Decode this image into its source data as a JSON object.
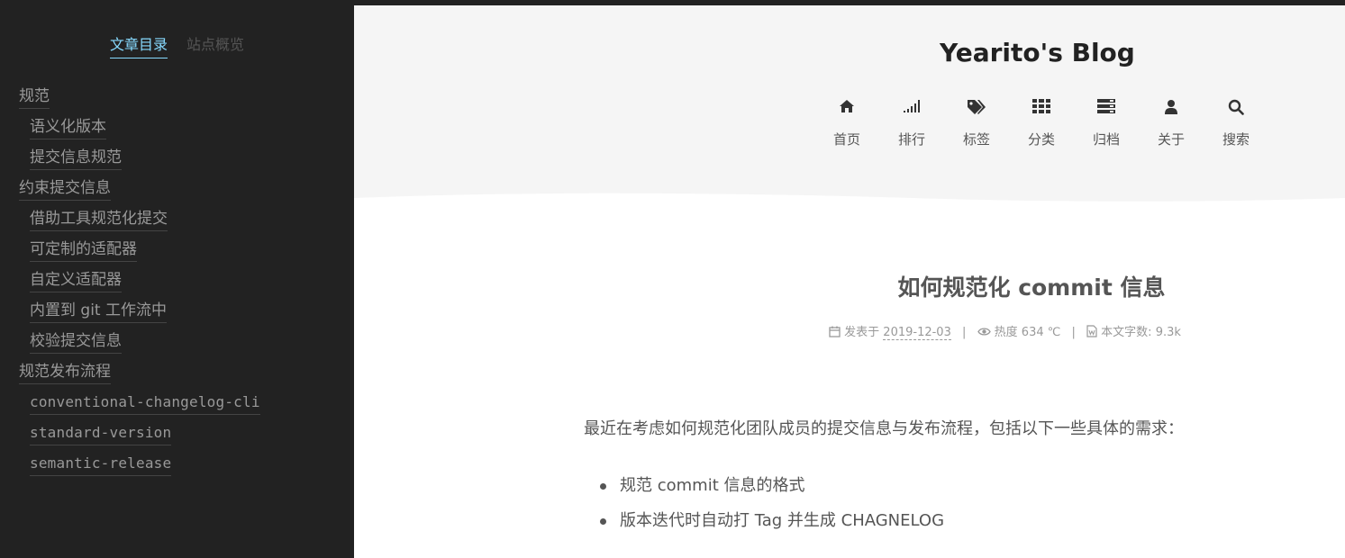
{
  "sidebar": {
    "tabs": [
      {
        "label": "文章目录",
        "active": true
      },
      {
        "label": "站点概览",
        "active": false
      }
    ],
    "toc": [
      {
        "label": "规范",
        "level": 1
      },
      {
        "label": "语义化版本",
        "level": 2
      },
      {
        "label": "提交信息规范",
        "level": 2
      },
      {
        "label": "约束提交信息",
        "level": 1
      },
      {
        "label": "借助工具规范化提交",
        "level": 2
      },
      {
        "label": "可定制的适配器",
        "level": 2
      },
      {
        "label": "自定义适配器",
        "level": 2
      },
      {
        "label": "内置到 git 工作流中",
        "level": 2
      },
      {
        "label": "校验提交信息",
        "level": 2
      },
      {
        "label": "规范发布流程",
        "level": 1
      },
      {
        "label": "conventional-changelog-cli",
        "level": 2
      },
      {
        "label": "standard-version",
        "level": 2
      },
      {
        "label": "semantic-release",
        "level": 2
      }
    ]
  },
  "header": {
    "site_title": "Yearito's Blog",
    "menu": [
      {
        "label": "首页",
        "icon": "home-icon"
      },
      {
        "label": "排行",
        "icon": "signal-icon"
      },
      {
        "label": "标签",
        "icon": "tags-icon"
      },
      {
        "label": "分类",
        "icon": "grid-icon"
      },
      {
        "label": "归档",
        "icon": "archive-icon"
      },
      {
        "label": "关于",
        "icon": "user-icon"
      },
      {
        "label": "搜索",
        "icon": "search-icon"
      }
    ]
  },
  "post": {
    "title": "如何规范化 commit 信息",
    "meta": {
      "posted_label": "发表于",
      "date": "2019-12-03",
      "heat_label": "热度 634 ℃",
      "words_label": "本文字数:",
      "words": "9.3k"
    },
    "intro": "最近在考虑如何规范化团队成员的提交信息与发布流程，包括以下一些具体的需求：",
    "list": [
      "规范 commit 信息的格式",
      "版本迭代时自动打 Tag 并生成 CHAGNELOG"
    ]
  },
  "colors": {
    "sidebar_bg": "#222222",
    "accent": "#87daff",
    "header_bg": "#f5f5f5"
  }
}
